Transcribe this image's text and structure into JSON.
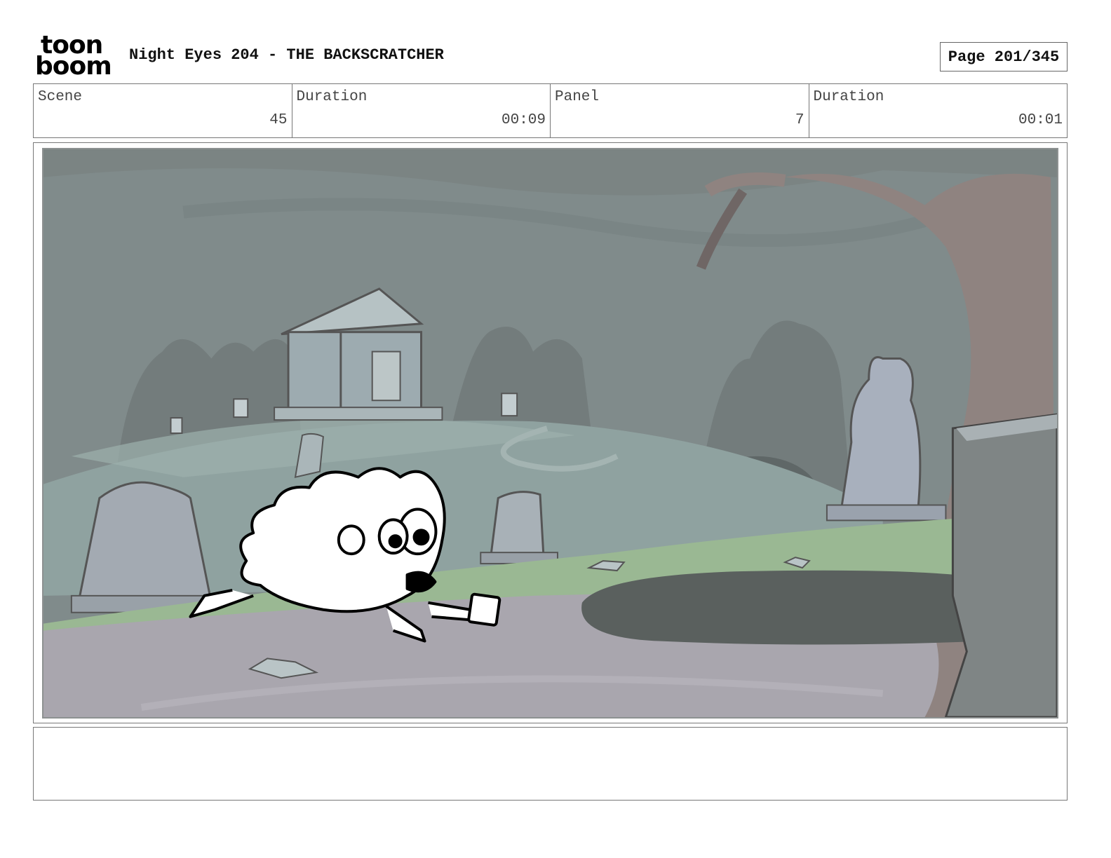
{
  "header": {
    "logo_line1": "toon",
    "logo_line2": "boom",
    "title": "Night Eyes 204 - THE BACKSCRATCHER",
    "page": "Page 201/345"
  },
  "info": {
    "scene_label": "Scene",
    "scene_value": "45",
    "scene_duration_label": "Duration",
    "scene_duration_value": "00:09",
    "panel_label": "Panel",
    "panel_value": "7",
    "panel_duration_label": "Duration",
    "panel_duration_value": "00:01"
  },
  "panel": {
    "description": "",
    "colors": {
      "sky": "#808b8b",
      "hill": "#8fa2a0",
      "grass": "#9ab893",
      "path": "#a9a6ae",
      "stone": "#a9b4bb",
      "tree": "#8f8380",
      "character_line": "#000000"
    }
  },
  "notes": {
    "text": ""
  }
}
